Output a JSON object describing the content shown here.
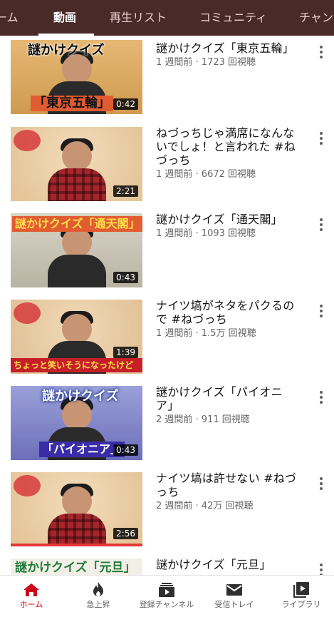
{
  "tabs": [
    {
      "label": "ーム",
      "active": false
    },
    {
      "label": "動画",
      "active": true
    },
    {
      "label": "再生リスト",
      "active": false
    },
    {
      "label": "コミュニティ",
      "active": false
    },
    {
      "label": "チャン",
      "active": false
    }
  ],
  "videos": [
    {
      "title": "謎かけクイズ「東京五輪」",
      "meta": "1 週間前 · 1723 回視聴",
      "duration": "0:42",
      "caption_top": "謎かけクイズ",
      "caption_bottom": "「東京五輪」",
      "watched": false
    },
    {
      "title": "ねづっちじゃ満席になんないでしょ！と言われた #ねづっち",
      "meta": "1 週間前 · 6672 回視聴",
      "duration": "2:21",
      "caption_top": "",
      "caption_bottom": "",
      "watched": false
    },
    {
      "title": "謎かけクイズ「通天閣」",
      "meta": "1 週間前 · 1093 回視聴",
      "duration": "0:43",
      "caption_top": "謎かけクイズ「通天閣」",
      "caption_bottom": "",
      "watched": false
    },
    {
      "title": "ナイツ塙がネタをパクるので #ねづっち",
      "meta": "1 週間前 · 1.5万 回視聴",
      "duration": "1:39",
      "caption_top": "",
      "caption_bottom": "ちょっと笑いそうになったけど",
      "watched": false
    },
    {
      "title": "謎かけクイズ「パイオニア」",
      "meta": "2 週間前 · 911 回視聴",
      "duration": "0:43",
      "caption_top": "謎かけクイズ",
      "caption_bottom": "「パイオニア」",
      "watched": false
    },
    {
      "title": "ナイツ塙は許せない #ねづっち",
      "meta": "2 週間前 · 42万 回視聴",
      "duration": "2:56",
      "caption_top": "",
      "caption_bottom": "",
      "watched": true
    },
    {
      "title": "謎かけクイズ「元旦」",
      "meta": "",
      "duration": "",
      "caption_top": "謎かけクイズ「元旦」",
      "caption_bottom": "",
      "watched": false
    }
  ],
  "bottom_nav": [
    {
      "label": "ホーム",
      "icon": "home-icon",
      "active": true
    },
    {
      "label": "急上昇",
      "icon": "trending-flame-icon",
      "active": false
    },
    {
      "label": "登録チャンネル",
      "icon": "subscriptions-icon",
      "active": false
    },
    {
      "label": "受信トレイ",
      "icon": "inbox-mail-icon",
      "active": false
    },
    {
      "label": "ライブラリ",
      "icon": "library-play-icon",
      "active": false
    }
  ],
  "colors": {
    "tab_bar_bg": "#4a2a29",
    "accent_red": "#d0021b",
    "progress_red": "#e53935"
  }
}
